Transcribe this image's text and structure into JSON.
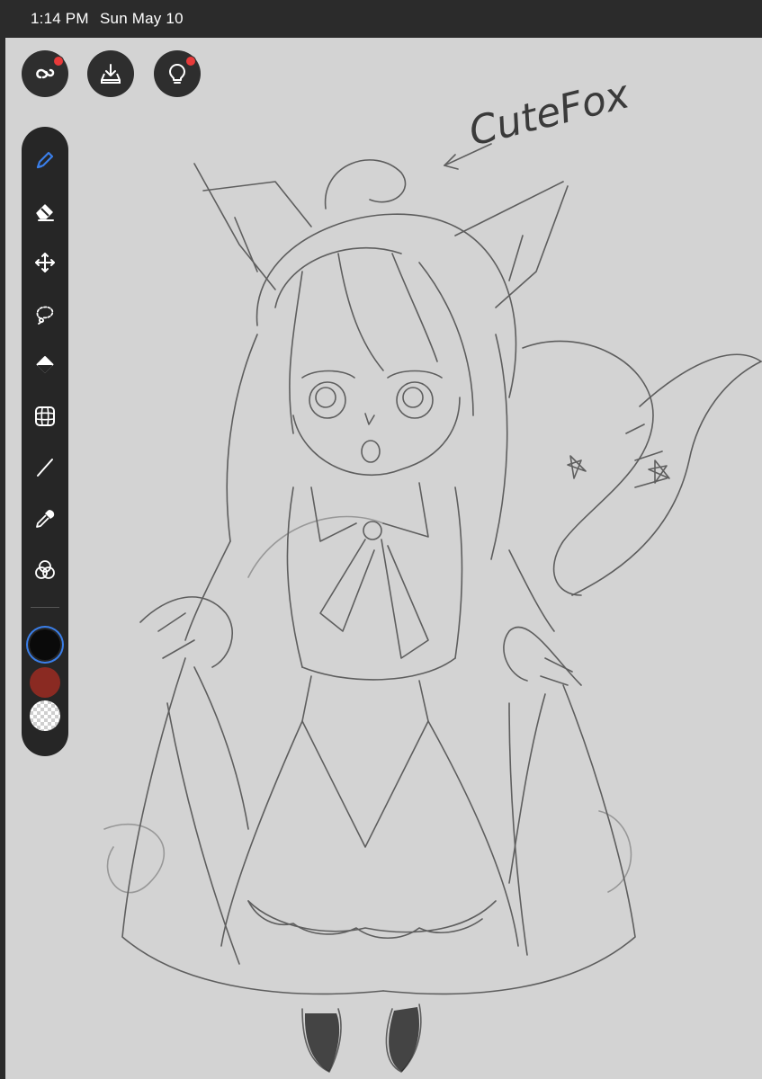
{
  "status_bar": {
    "time": "1:14 PM",
    "date": "Sun May 10"
  },
  "top_buttons": [
    {
      "icon": "cloud-sync-icon",
      "has_notification": true
    },
    {
      "icon": "export-download-icon",
      "has_notification": false
    },
    {
      "icon": "lightbulb-tips-icon",
      "has_notification": true
    }
  ],
  "toolbar": {
    "tools": [
      {
        "name": "pen-tool",
        "icon": "pen-icon",
        "active": true
      },
      {
        "name": "eraser-tool",
        "icon": "eraser-icon",
        "active": false
      },
      {
        "name": "move-tool",
        "icon": "move-arrows-icon",
        "active": false
      },
      {
        "name": "lasso-tool",
        "icon": "lasso-icon",
        "active": false
      },
      {
        "name": "fill-tool",
        "icon": "paint-bucket-icon",
        "active": false
      },
      {
        "name": "grid-tool",
        "icon": "grid-icon",
        "active": false
      },
      {
        "name": "line-tool",
        "icon": "line-icon",
        "active": false
      },
      {
        "name": "eyedropper-tool",
        "icon": "eyedropper-icon",
        "active": false
      },
      {
        "name": "color-mixer-tool",
        "icon": "color-circles-icon",
        "active": false
      }
    ],
    "colors": {
      "primary": "#0a0a0a",
      "secondary": "#8a2a22",
      "background": "transparent"
    },
    "accent": "#3a7ee8"
  },
  "canvas": {
    "background": "#d3d3d3",
    "annotation": "CuteFox"
  }
}
